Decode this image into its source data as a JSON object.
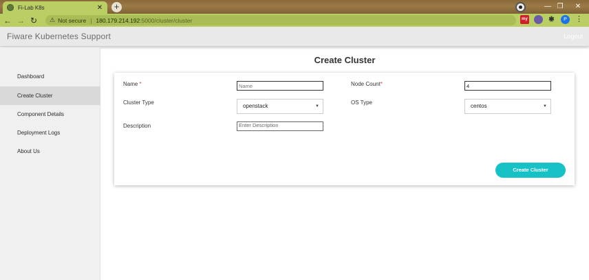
{
  "browser": {
    "tab_title": "Fi-Lab K8s",
    "tab_close": "✕",
    "new_tab": "+",
    "security_label": "Not secure",
    "url_host": "180.179.214.192",
    "url_path": ":5000/cluster/cluster",
    "ext_label": "my",
    "profile_initial": "P"
  },
  "app": {
    "brand": "Fiware Kubernetes Support",
    "logout": "Logout"
  },
  "sidebar": {
    "items": [
      {
        "label": "Dashboard",
        "active": false
      },
      {
        "label": "Create Cluster",
        "active": true
      },
      {
        "label": "Component Details",
        "active": false
      },
      {
        "label": "Deployment Logs",
        "active": false
      },
      {
        "label": "About Us",
        "active": false
      }
    ]
  },
  "page": {
    "title": "Create Cluster"
  },
  "form": {
    "name_label": "Name",
    "name_placeholder": "Name",
    "required_mark": "*",
    "node_count_label": "Node Count",
    "node_count_value": "4",
    "cluster_type_label": "Cluster Type",
    "cluster_type_value": "openstack",
    "os_type_label": "OS Type",
    "os_type_value": "centos",
    "description_label": "Description",
    "description_placeholder": "Enter Description",
    "submit_label": "Create Cluster"
  },
  "colors": {
    "accent": "#16c2c6",
    "required": "#e53935",
    "browser_theme": "#b9cf63"
  }
}
